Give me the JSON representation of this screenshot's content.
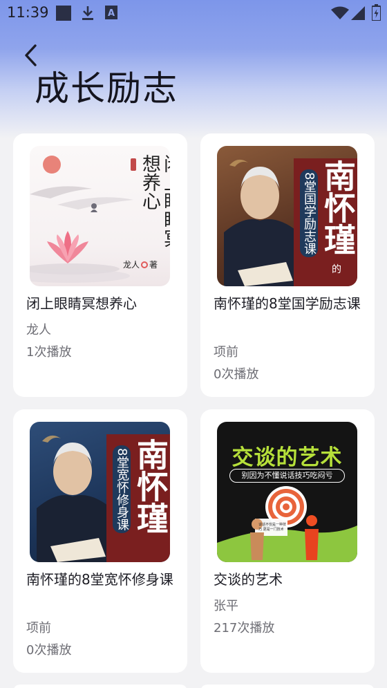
{
  "status_bar": {
    "time": "11:39",
    "left_icons": [
      "square-notification-icon",
      "download-icon",
      "font-a-icon"
    ],
    "right_icons": [
      "wifi-icon",
      "signal-icon",
      "battery-icon"
    ]
  },
  "header": {
    "back_icon": "chevron-left-icon",
    "title": "成长励志"
  },
  "covers": {
    "cover1": {
      "title_vertical": "闭上眼睛冥想养心",
      "author": "龙人",
      "author_suffix": "著"
    },
    "cover2": {
      "big_name": "南怀瑾",
      "subtitle": "8堂国学励志课",
      "suffix": "的"
    },
    "cover3": {
      "big_name": "南怀瑾",
      "subtitle": "8堂宽怀修身课"
    },
    "cover4": {
      "title": "交谈的艺术",
      "subtitle": "别因为不懂说话技巧吃闷亏",
      "bubble_text": "谈话不仅是一种技巧 更是一门技术"
    }
  },
  "items": [
    {
      "title": "闭上眼睛冥想养心",
      "author": "龙人",
      "plays": "1次播放"
    },
    {
      "title": "南怀瑾的8堂国学励志课",
      "author": "项前",
      "plays": "0次播放"
    },
    {
      "title": "南怀瑾的8堂宽怀修身课",
      "author": "项前",
      "plays": "0次播放"
    },
    {
      "title": "交谈的艺术",
      "author": "张平",
      "plays": "217次播放"
    }
  ]
}
